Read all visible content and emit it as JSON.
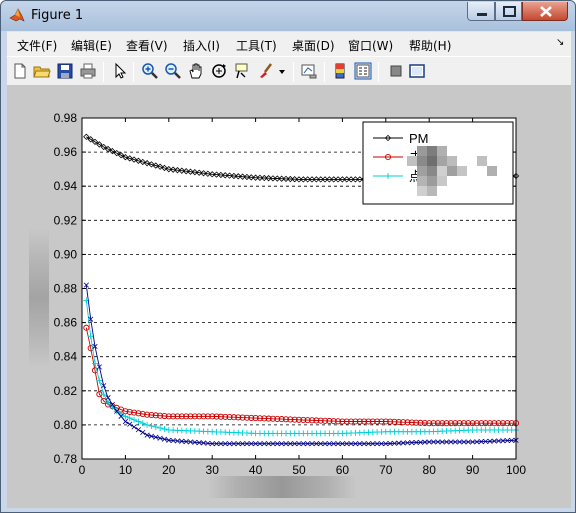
{
  "window": {
    "title": "Figure 1"
  },
  "menu": [
    {
      "label": "文件(F)",
      "name": "menu-file"
    },
    {
      "label": "编辑(E)",
      "name": "menu-edit"
    },
    {
      "label": "查看(V)",
      "name": "menu-view"
    },
    {
      "label": "插入(I)",
      "name": "menu-insert"
    },
    {
      "label": "工具(T)",
      "name": "menu-tools"
    },
    {
      "label": "桌面(D)",
      "name": "menu-desktop"
    },
    {
      "label": "窗口(W)",
      "name": "menu-window"
    },
    {
      "label": "帮助(H)",
      "name": "menu-help"
    }
  ],
  "toolbar": [
    "new-figure-icon",
    "open-file-icon",
    "save-icon",
    "print-icon",
    "select-arrow-icon",
    "zoom-in-icon",
    "zoom-out-icon",
    "pan-hand-icon",
    "rotate-3d-icon",
    "data-cursor-icon",
    "brush-icon",
    "brush-dropdown-icon",
    "link-plot-icon",
    "colorbar-icon",
    "legend-icon",
    "hide-plot-tools-icon",
    "show-plot-tools-icon"
  ],
  "colors": {
    "series1": "#000000",
    "series2": "#cc0000",
    "series3": "#00d0d8",
    "series4": "#00008b",
    "grid": "#000000"
  },
  "chart_data": {
    "type": "line",
    "xlim": [
      0,
      100
    ],
    "ylim": [
      0.78,
      0.98
    ],
    "xticks": [
      0,
      10,
      20,
      30,
      40,
      50,
      60,
      70,
      80,
      90,
      100
    ],
    "yticks": [
      0.78,
      0.8,
      0.82,
      0.84,
      0.86,
      0.88,
      0.9,
      0.92,
      0.94,
      0.96,
      0.98
    ],
    "grid": "horizontal dashed",
    "legend_position": "top-right",
    "legend_entries": [
      {
        "label": "PM",
        "marker": "diamond",
        "color": "#000000"
      },
      {
        "label": "去",
        "marker": "circle",
        "color": "#cc0000"
      },
      {
        "label": "点",
        "marker": "plus",
        "color": "#00d0d8"
      }
    ],
    "series": [
      {
        "marker": "diamond",
        "color": "#000000",
        "points": [
          [
            1,
            0.969
          ],
          [
            5,
            0.963
          ],
          [
            10,
            0.957
          ],
          [
            20,
            0.95
          ],
          [
            30,
            0.947
          ],
          [
            40,
            0.945
          ],
          [
            50,
            0.944
          ],
          [
            60,
            0.944
          ],
          [
            70,
            0.944
          ],
          [
            80,
            0.944
          ],
          [
            90,
            0.945
          ],
          [
            100,
            0.946
          ]
        ]
      },
      {
        "marker": "circle",
        "color": "#cc0000",
        "points": [
          [
            1,
            0.857
          ],
          [
            2,
            0.845
          ],
          [
            3,
            0.832
          ],
          [
            4,
            0.818
          ],
          [
            5,
            0.814
          ],
          [
            6,
            0.812
          ],
          [
            8,
            0.81
          ],
          [
            10,
            0.808
          ],
          [
            15,
            0.806
          ],
          [
            20,
            0.805
          ],
          [
            30,
            0.805
          ],
          [
            40,
            0.804
          ],
          [
            50,
            0.803
          ],
          [
            60,
            0.802
          ],
          [
            70,
            0.802
          ],
          [
            80,
            0.801
          ],
          [
            90,
            0.801
          ],
          [
            100,
            0.801
          ]
        ]
      },
      {
        "marker": "plus",
        "color": "#00d0d8",
        "points": [
          [
            1,
            0.873
          ],
          [
            2,
            0.852
          ],
          [
            3,
            0.836
          ],
          [
            4,
            0.826
          ],
          [
            5,
            0.818
          ],
          [
            6,
            0.813
          ],
          [
            8,
            0.808
          ],
          [
            10,
            0.805
          ],
          [
            15,
            0.8
          ],
          [
            20,
            0.797
          ],
          [
            30,
            0.796
          ],
          [
            40,
            0.795
          ],
          [
            50,
            0.795
          ],
          [
            60,
            0.795
          ],
          [
            70,
            0.796
          ],
          [
            80,
            0.796
          ],
          [
            90,
            0.797
          ],
          [
            100,
            0.797
          ]
        ]
      },
      {
        "marker": "x",
        "color": "#00008b",
        "points": [
          [
            1,
            0.882
          ],
          [
            2,
            0.862
          ],
          [
            3,
            0.846
          ],
          [
            4,
            0.834
          ],
          [
            5,
            0.823
          ],
          [
            6,
            0.816
          ],
          [
            8,
            0.808
          ],
          [
            10,
            0.802
          ],
          [
            15,
            0.794
          ],
          [
            20,
            0.791
          ],
          [
            25,
            0.79
          ],
          [
            30,
            0.789
          ],
          [
            40,
            0.789
          ],
          [
            50,
            0.789
          ],
          [
            60,
            0.789
          ],
          [
            70,
            0.789
          ],
          [
            80,
            0.79
          ],
          [
            90,
            0.79
          ],
          [
            100,
            0.791
          ]
        ]
      }
    ]
  }
}
